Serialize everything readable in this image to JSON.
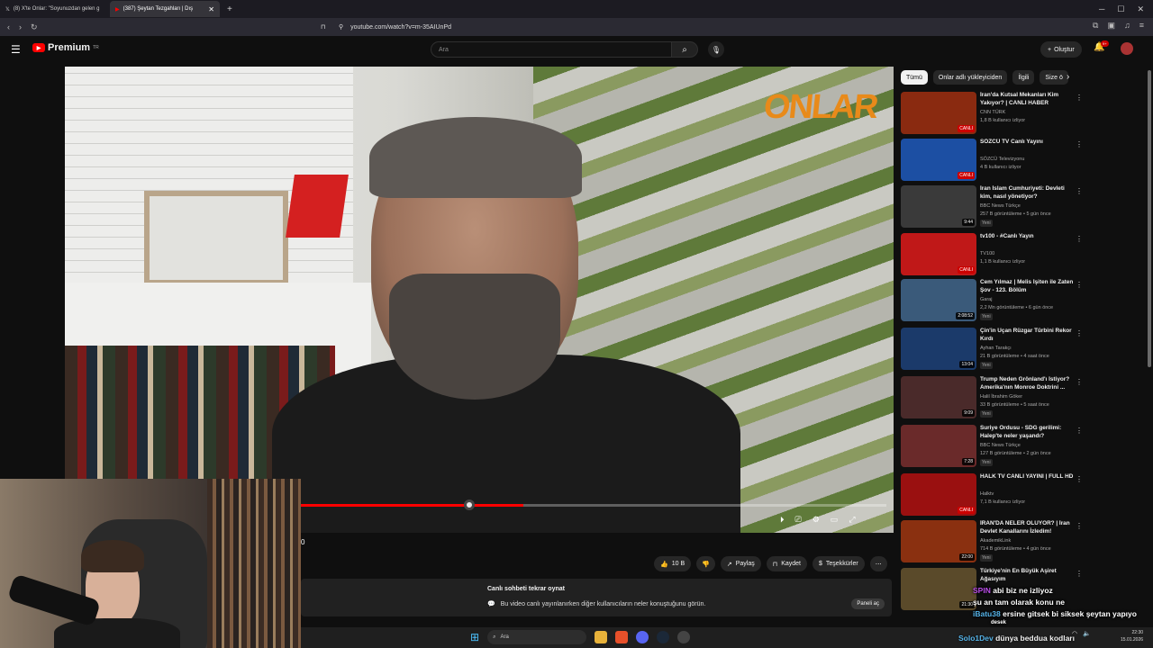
{
  "browser": {
    "tabs": [
      {
        "title": "(8) X'te Onlar: \"Soyunuzdan gelen g"
      },
      {
        "title": "(387) Şeytan Tezgahları | Dış"
      }
    ],
    "url": "youtube.com/watch?v=m-35AIUnPd"
  },
  "youtube": {
    "brand": "Premium",
    "brand_sup": "TR",
    "search_placeholder": "Ara",
    "create_label": "Oluştur",
    "notif_count": "9+"
  },
  "video": {
    "watermark": "ONLAR",
    "time": "0",
    "progress": 0.38
  },
  "actions": {
    "like_count": "10 B",
    "share": "Paylaş",
    "save": "Kaydet",
    "thanks": "Teşekkürler"
  },
  "chat": {
    "title": "Canlı sohbeti tekrar oynat",
    "desc": "Bu video canlı yayınlanırken diğer kullanıcıların neler konuştuğunu görün.",
    "button": "Paneli aç"
  },
  "chips": [
    "Tümü",
    "Onlar adlı yükleyiciden",
    "İlgili",
    "Size ö"
  ],
  "recommendations": [
    {
      "title": "İran'da Kutsal Mekanları Kim Yakıyor? | CANLI HABER",
      "channel": "CNN TÜRK",
      "meta": "1,8 B kullanıcı izliyor",
      "badge": "CANLI",
      "color": "#8a2a10",
      "new": ""
    },
    {
      "title": "SÖZCÜ TV Canlı Yayını",
      "channel": "SÖZCÜ Televizyonu",
      "meta": "4 B kullanıcı izliyor",
      "badge": "CANLI",
      "color": "#1c4fa3",
      "new": ""
    },
    {
      "title": "İran İslam Cumhuriyeti: Devleti kim, nasıl yönetiyor?",
      "channel": "BBC News Türkçe",
      "meta": "257 B görüntüleme • 5 gün önce",
      "badge": "9:44",
      "color": "#3a3a3a",
      "new": "Yeni"
    },
    {
      "title": "tv100 - #Canlı Yayın",
      "channel": "TV100",
      "meta": "1,1 B kullanıcı izliyor",
      "badge": "CANLI",
      "color": "#c01818",
      "new": ""
    },
    {
      "title": "Cem Yılmaz | Melis İşiten ile Zaten Şov - 123. Bölüm",
      "channel": "Garaj",
      "meta": "2,2 Mn görüntüleme • 6 gün önce",
      "badge": "2:08:52",
      "color": "#3a5a7a",
      "new": "Yeni"
    },
    {
      "title": "Çin'in Uçan Rüzgar Türbini Rekor Kırdı",
      "channel": "Ayhan Tarakçı",
      "meta": "21 B görüntüleme • 4 saat önce",
      "badge": "13:04",
      "color": "#1b3a6a",
      "new": "Yeni"
    },
    {
      "title": "Trump Neden Grönland'ı İstiyor? Amerika'nın Monroe Doktrini ...",
      "channel": "Halil İbrahim Göker",
      "meta": "33 B görüntüleme • 5 saat önce",
      "badge": "9:09",
      "color": "#4a2a2a",
      "new": "Yeni"
    },
    {
      "title": "Suriye Ordusu - SDG gerilimi: Halep'te neler yaşandı?",
      "channel": "BBC News Türkçe",
      "meta": "127 B görüntüleme • 2 gün önce",
      "badge": "7:28",
      "color": "#6a2a2a",
      "new": "Yeni"
    },
    {
      "title": "HALK TV CANLI YAYINI | FULL HD",
      "channel": "Halktv",
      "meta": "7,1 B kullanıcı izliyor",
      "badge": "CANLI",
      "color": "#9a1010",
      "new": ""
    },
    {
      "title": "İRAN'DA NELER OLUYOR? | İran Devlet Kanallarını İzledim!",
      "channel": "AkademikLink",
      "meta": "714 B görüntüleme • 4 gün önce",
      "badge": "22:00",
      "color": "#8a3010",
      "new": "Yeni"
    },
    {
      "title": "Türkiye'nin En Büyük Aşiret Ağasıyım",
      "channel": "",
      "meta": "",
      "badge": "21:30",
      "color": "#5a4a2a",
      "new": ""
    }
  ],
  "stream_chat": [
    {
      "user": "SPIN",
      "text": "abi biz ne izliyoz"
    },
    {
      "user": "",
      "text": "şu an tam olarak konu ne"
    },
    {
      "user": "iBatu38",
      "text": "ersine gitsek bi siksek şeytan yapıyo"
    },
    {
      "user": "",
      "text": "desek"
    }
  ],
  "stream_bottom": {
    "user": "Solo1Dev",
    "text": "dünya beddua kodları"
  },
  "taskbar": {
    "search": "Ara",
    "time": "22:30",
    "date": "15.01.2026"
  }
}
